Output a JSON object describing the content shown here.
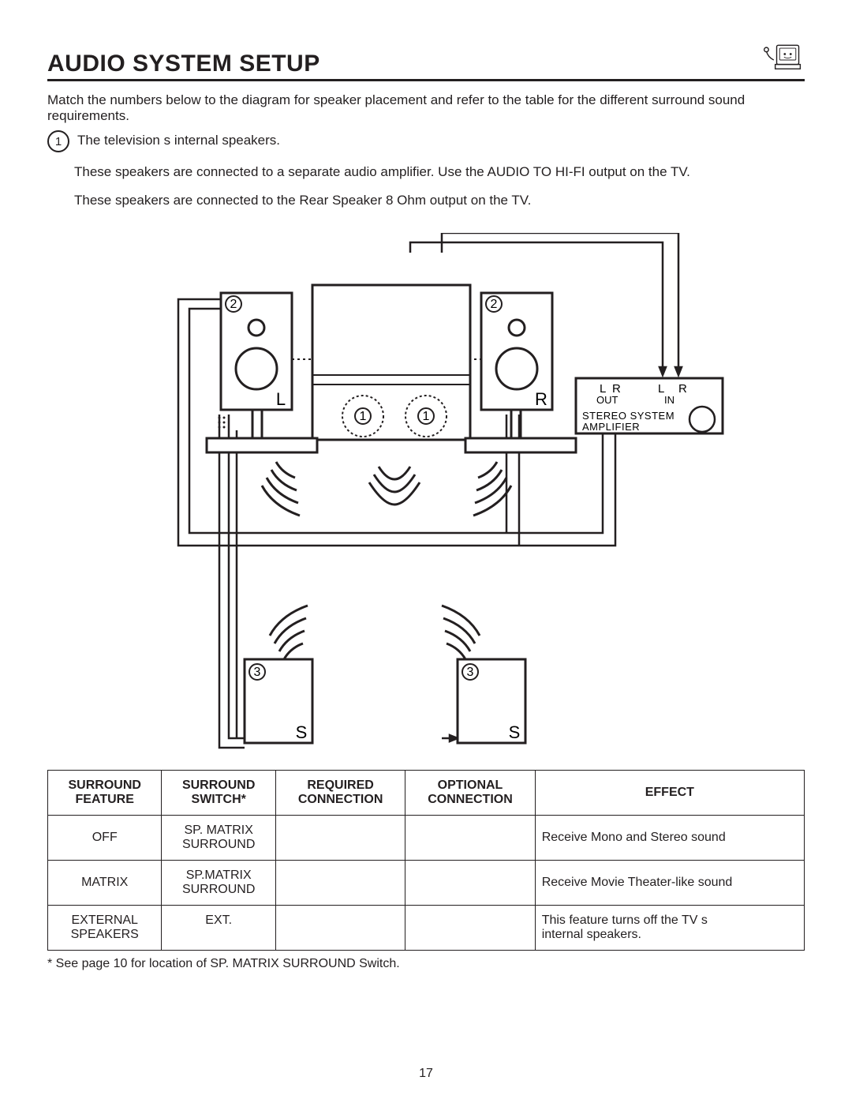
{
  "header": {
    "title": "AUDIO SYSTEM SETUP"
  },
  "intro": "Match the numbers below to the diagram for speaker placement and refer to the table for the different surround sound requirements.",
  "bullets": {
    "b1_num": "1",
    "b1_text": "The television s internal speakers.",
    "b2_text": "These speakers are connected to a separate audio amplifier.  Use the  AUDIO TO HI-FI  output on the TV.",
    "b3_text": "These speakers are connected to the Rear Speaker 8 Ohm output on the TV."
  },
  "diagram": {
    "label_2a": "2",
    "label_2b": "2",
    "label_1a": "1",
    "label_1b": "1",
    "label_3a": "3",
    "label_3b": "3",
    "label_L": "L",
    "label_R": "R",
    "label_S1": "S",
    "label_S2": "S",
    "amp_out_L": "L",
    "amp_out_R": "R",
    "amp_out_label": "OUT",
    "amp_in_L": "L",
    "amp_in_R": "R",
    "amp_in_label": "IN",
    "amp_text1": "STEREO SYSTEM",
    "amp_text2": "AMPLIFIER"
  },
  "table": {
    "headers": {
      "c1a": "SURROUND",
      "c1b": "FEATURE",
      "c2a": "SURROUND",
      "c2b": "SWITCH*",
      "c3a": "REQUIRED",
      "c3b": "CONNECTION",
      "c4a": "OPTIONAL",
      "c4b": "CONNECTION",
      "c5": "EFFECT"
    },
    "rows": [
      {
        "feature": "OFF",
        "switch_l1": "SP. MATRIX",
        "switch_l2": "SURROUND",
        "req": "",
        "opt": "",
        "effect": "Receive Mono and Stereo sound"
      },
      {
        "feature": "MATRIX",
        "switch_l1": "SP.MATRIX",
        "switch_l2": "SURROUND",
        "req": "",
        "opt": "",
        "effect": "Receive Movie Theater-like sound"
      },
      {
        "feature_l1": "EXTERNAL",
        "feature_l2": "SPEAKERS",
        "switch_l1": "EXT.",
        "switch_l2": "",
        "req": "",
        "opt": "",
        "effect_l1": "This feature turns off the TV s",
        "effect_l2": "internal speakers."
      }
    ]
  },
  "footnote": "* See page 10 for location of SP. MATRIX SURROUND Switch.",
  "page_number": "17"
}
